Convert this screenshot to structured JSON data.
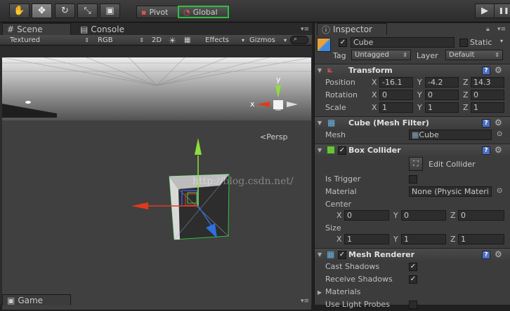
{
  "toolbar": {
    "tools": [
      {
        "name": "hand-tool",
        "icon": "✋"
      },
      {
        "name": "move-tool",
        "icon": "✥"
      },
      {
        "name": "rotate-tool",
        "icon": "↻"
      },
      {
        "name": "scale-tool",
        "icon": "⤡"
      },
      {
        "name": "rect-tool",
        "icon": "▣"
      }
    ],
    "pivot_label": "Pivot",
    "global_label": "Global",
    "play_icon": "▶",
    "pause_icon": "❚❚"
  },
  "scene_tabs": {
    "scene": "Scene",
    "console": "Console"
  },
  "scene_bar": {
    "shading": "Textured",
    "render_mode": "RGB",
    "mode_2d": "2D",
    "effects": "Effects",
    "gizmos": "Gizmos"
  },
  "viewport": {
    "persp_label": "Persp",
    "gizmo_x": "x",
    "gizmo_y": "y",
    "watermark": "http://blog.csdn.net/"
  },
  "game_tab": "Game",
  "inspector": {
    "tab": "Inspector",
    "object_name": "Cube",
    "static_label": "Static",
    "tag_label": "Tag",
    "tag_value": "Untagged",
    "layer_label": "Layer",
    "layer_value": "Default",
    "transform": {
      "title": "Transform",
      "position_label": "Position",
      "rotation_label": "Rotation",
      "scale_label": "Scale",
      "position": {
        "x": "-16.1",
        "y": "-4.2",
        "z": "14.3"
      },
      "rotation": {
        "x": "0",
        "y": "0",
        "z": "0"
      },
      "scale": {
        "x": "1",
        "y": "1",
        "z": "1"
      }
    },
    "mesh_filter": {
      "title": "Cube (Mesh Filter)",
      "mesh_label": "Mesh",
      "mesh_value": "Cube"
    },
    "box_collider": {
      "title": "Box Collider",
      "edit_label": "Edit Collider",
      "trigger_label": "Is Trigger",
      "material_label": "Material",
      "material_value": "None (Physic Materi",
      "center_label": "Center",
      "size_label": "Size",
      "center": {
        "x": "0",
        "y": "0",
        "z": "0"
      },
      "size": {
        "x": "1",
        "y": "1",
        "z": "1"
      }
    },
    "mesh_renderer": {
      "title": "Mesh Renderer",
      "cast_label": "Cast Shadows",
      "receive_label": "Receive Shadows",
      "materials_label": "Materials",
      "light_probes_label": "Use Light Probes"
    }
  },
  "axis_labels": {
    "x": "X",
    "y": "Y",
    "z": "Z"
  },
  "colors": {
    "selected_outline": "#2fbf3f",
    "gizmo_x": "#e03a1e",
    "gizmo_y": "#8ce03a",
    "gizmo_z": "#2f6fe0"
  }
}
